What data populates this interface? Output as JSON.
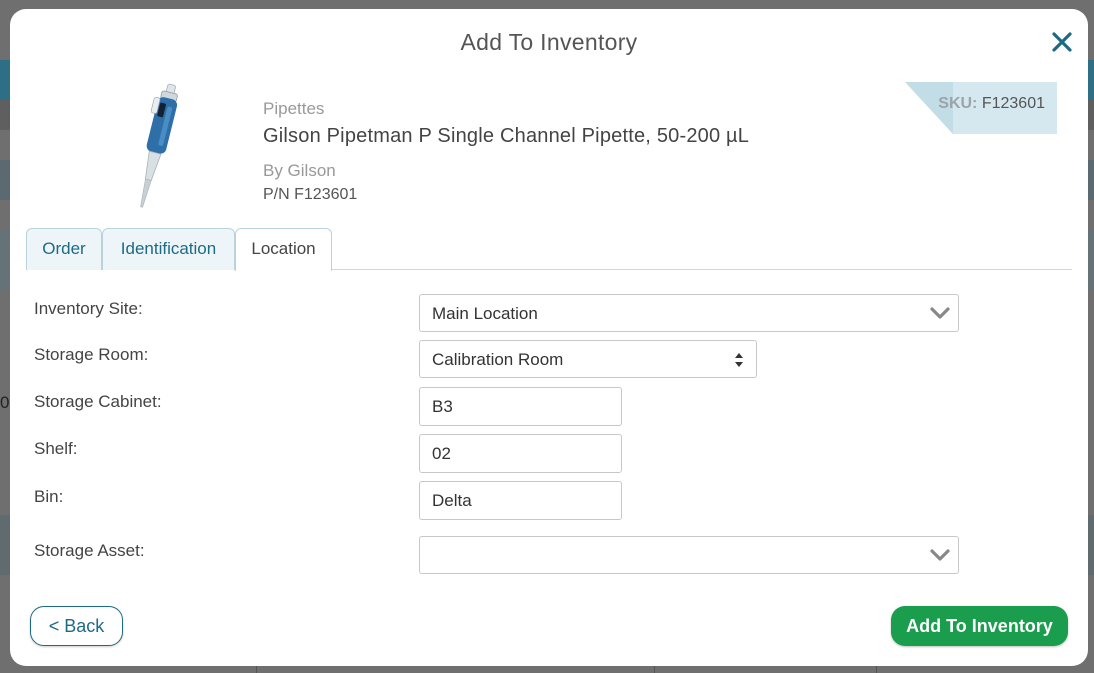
{
  "background": {
    "edge_text": "0"
  },
  "modal": {
    "title": "Add To Inventory",
    "close_icon": "close-icon"
  },
  "product": {
    "category": "Pipettes",
    "name": "Gilson Pipetman P Single Channel Pipette, 50-200 µL",
    "brand": "By Gilson",
    "part_number": "P/N F123601",
    "sku_label": "SKU:",
    "sku_value": "F123601",
    "image_icon": "pipette-icon"
  },
  "tabs": [
    {
      "label": "Order",
      "active": false
    },
    {
      "label": "Identification",
      "active": false
    },
    {
      "label": "Location",
      "active": true
    }
  ],
  "form": {
    "inventory_site": {
      "label": "Inventory Site:",
      "value": "Main Location"
    },
    "storage_room": {
      "label": "Storage Room:",
      "value": "Calibration Room"
    },
    "storage_cabinet": {
      "label": "Storage Cabinet:",
      "value": "B3"
    },
    "shelf": {
      "label": "Shelf:",
      "value": "02"
    },
    "bin": {
      "label": "Bin:",
      "value": "Delta"
    },
    "storage_asset": {
      "label": "Storage Asset:",
      "value": ""
    }
  },
  "footer": {
    "back_label": "< Back",
    "add_label": "Add To Inventory"
  },
  "colors": {
    "accent": "#1d6a85",
    "primary_button": "#1a9e4e",
    "tab_bg": "#eef5f8",
    "sku_bg": "#d5e8ef"
  }
}
